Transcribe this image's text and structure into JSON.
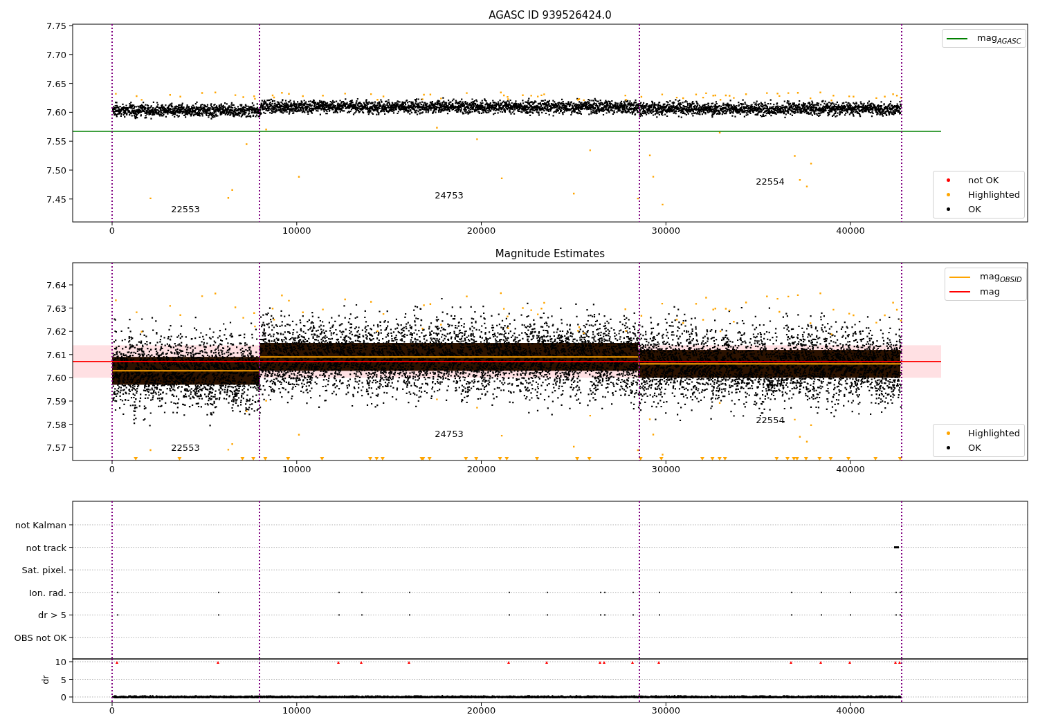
{
  "panels": [
    {
      "kind": "mag_agasc",
      "title": "AGASC ID 939526424.0",
      "yticks": [
        "7.75",
        "7.70",
        "7.65",
        "7.60",
        "7.55",
        "7.50",
        "7.45"
      ],
      "xticks": [
        "0",
        "10000",
        "20000",
        "30000",
        "40000"
      ],
      "obsid_labels": [
        "22553",
        "24753",
        "22554"
      ],
      "legends": [
        [
          {
            "kind": "line",
            "label": "mag$_{AGASC}$",
            "color": "#008000"
          }
        ],
        [
          {
            "kind": "dot",
            "label": "not OK",
            "color": "#ff0000"
          },
          {
            "kind": "dot",
            "label": "Highlighted",
            "color": "#ffa500"
          },
          {
            "kind": "dot",
            "label": "OK",
            "color": "#000000"
          }
        ]
      ]
    },
    {
      "kind": "mag_estimates",
      "title": "Magnitude Estimates",
      "yticks": [
        "7.64",
        "7.63",
        "7.62",
        "7.61",
        "7.60",
        "7.59",
        "7.58",
        "7.57"
      ],
      "xticks": [
        "0",
        "10000",
        "20000",
        "30000",
        "40000"
      ],
      "obsid_labels": [
        "22553",
        "24753",
        "22554"
      ],
      "legends": [
        [
          {
            "kind": "line",
            "label": "mag$_{OBSID}$",
            "color": "#ffa500"
          },
          {
            "kind": "line",
            "label": "mag",
            "color": "#ff0000"
          }
        ],
        [
          {
            "kind": "dot",
            "label": "Highlighted",
            "color": "#ffa500"
          },
          {
            "kind": "dot",
            "label": "OK",
            "color": "#000000"
          }
        ]
      ]
    },
    {
      "kind": "flags",
      "yticks": [
        "not Kalman",
        "not track",
        "Sat. pixel.",
        "Ion. rad.",
        "dr > 5",
        "OBS not OK"
      ]
    },
    {
      "kind": "dr",
      "ylabel": "dr",
      "yticks": [
        "10",
        "5",
        "0"
      ],
      "xticks": [
        "0",
        "10000",
        "20000",
        "30000",
        "40000"
      ]
    }
  ]
}
